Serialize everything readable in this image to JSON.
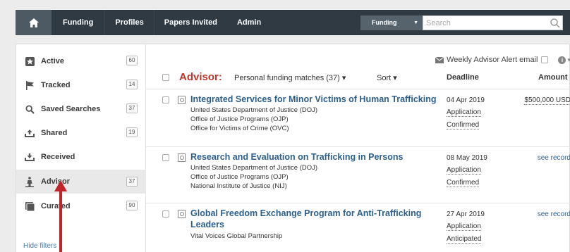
{
  "nav": {
    "items": [
      {
        "label": "Funding"
      },
      {
        "label": "Profiles"
      },
      {
        "label": "Papers Invited"
      },
      {
        "label": "Admin"
      }
    ],
    "search_scope": "Funding",
    "search_placeholder": "Search"
  },
  "sidebar": {
    "items": [
      {
        "label": "Active",
        "count": "60",
        "icon": "star-icon"
      },
      {
        "label": "Tracked",
        "count": "14",
        "icon": "flag-icon"
      },
      {
        "label": "Saved Searches",
        "count": "37",
        "icon": "search-icon"
      },
      {
        "label": "Shared",
        "count": "19",
        "icon": "share-icon"
      },
      {
        "label": "Received",
        "count": "",
        "icon": "inbox-icon"
      },
      {
        "label": "Advisor",
        "count": "37",
        "icon": "advisor-icon"
      },
      {
        "label": "Curated",
        "count": "90",
        "icon": "book-icon"
      }
    ],
    "hide_filters": "Hide filters"
  },
  "content": {
    "alert_label": "Weekly Advisor Alert email",
    "heading": "Advisor:",
    "matches_label": "Personal funding matches (37) ▾",
    "sort_label": "Sort ▾",
    "col_deadline": "Deadline",
    "col_amount": "Amount",
    "results": [
      {
        "title": "Integrated Services for Minor Victims of Human Trafficking",
        "orgs": [
          "United States Department of Justice (DOJ)",
          "Office of Justice Programs (OJP)",
          "Office for Victims of Crime (OVC)"
        ],
        "deadline": "04 Apr 2019",
        "status1": "Application",
        "status2": "Confirmed",
        "amount": "$500,000 USD"
      },
      {
        "title": "Research and Evaluation on Trafficking in Persons",
        "orgs": [
          "United States Department of Justice (DOJ)",
          "Office of Justice Programs (OJP)",
          "National Institute of Justice (NIJ)"
        ],
        "deadline": "08 May 2019",
        "status1": "Application",
        "status2": "Confirmed",
        "amount": "see record"
      },
      {
        "title": "Global Freedom Exchange Program for Anti-Trafficking Leaders",
        "orgs": [
          "Vital Voices Global Partnership"
        ],
        "deadline": "27 Apr 2019",
        "status1": "Application",
        "status2": "Anticipated",
        "amount": "see record"
      }
    ]
  },
  "colors": {
    "nav_bg": "#2f3a43",
    "accent_red": "#c0362c",
    "link_blue": "#2c5f8d",
    "annotation_arrow": "#c2242a"
  }
}
